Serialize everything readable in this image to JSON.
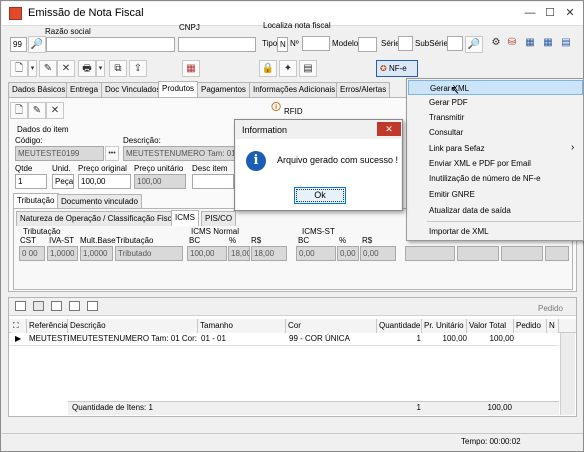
{
  "window": {
    "title": "Emissão de Nota Fiscal",
    "minimize": "—",
    "maximize": "☐",
    "close": "✕"
  },
  "form": {
    "razao_social_label": "Razão social",
    "cnpj_label": "CNPJ",
    "localiza_label": "Localiza nota fiscal",
    "tipo_label": "Tipo",
    "tipo_value": "N",
    "no_label": "Nº",
    "modelo_label": "Modelo",
    "serie_label": "Série",
    "subserie_label": "SubSérie",
    "prefix_value": "99"
  },
  "toolbar": {
    "nfe_label": "NF-e"
  },
  "tabs": [
    "Dados Básicos",
    "Entrega",
    "Doc Vinculados",
    "Produtos",
    "Pagamentos",
    "Informações Adicionais",
    "Erros/Alertas"
  ],
  "rfid_label": "RFID",
  "item": {
    "section_label": "Dados do item",
    "codigo_label": "Código:",
    "codigo_value": "MEUTESTE0199",
    "codigo_btn": "•••",
    "descricao_label": "Descrição:",
    "descricao_value": "MEUTESTENUMERO Tam: 01",
    "qtde_label": "Qtde",
    "qtde_value": "1",
    "unid_label": "Unid.",
    "unid_value": "Peça",
    "preco_original_label": "Preço original",
    "preco_original_value": "100,00",
    "preco_unitario_label": "Preço unitário",
    "preco_unitario_value": "100,00",
    "desc_item_label": "Desc item"
  },
  "subtabs": [
    "Tributação",
    "Documento vinculado"
  ],
  "taxtabs": [
    "Natureza de Operação / Classificação Fiscal",
    "ICMS",
    "PIS/CO"
  ],
  "tributacao": {
    "group_label": "Tributação",
    "icms_normal_label": "ICMS Normal",
    "icms_st_label": "ICMS-ST",
    "cols": [
      "CST",
      "IVA-ST",
      "Mult.Base",
      "Tributação",
      "BC",
      "%",
      "R$",
      "BC",
      "%",
      "R$"
    ],
    "values": [
      "0 00",
      "1,0000",
      "1,0000",
      "Tributado",
      "100,00",
      "18,00",
      "18,00",
      "0,00",
      "0,00",
      "0,00"
    ]
  },
  "grid": {
    "pedido_label": "Pedido",
    "headers": [
      "Referência",
      "Descrição",
      "Tamanho",
      "Cor",
      "Quantidade",
      "Pr. Unitário",
      "Valor Total",
      "Pedido",
      "N"
    ],
    "rows": [
      {
        "ref": "MEUTESTE",
        "desc": "MEUTESTENUMERO Tam: 01 Cor: CO",
        "tamanho": "01 - 01",
        "cor": "99 - COR ÚNICA",
        "qtd": "1",
        "unit": "100,00",
        "total": "100,00",
        "pedido": ""
      }
    ],
    "footer_label": "Quantidade de Itens: 1",
    "footer_qtd": "1",
    "footer_total": "100,00"
  },
  "status": {
    "tempo": "Tempo: 00:00:02"
  },
  "menu": {
    "items": [
      "Gerar XML",
      "Gerar PDF",
      "Transmitir",
      "Consultar",
      "Link para Sefaz",
      "Enviar XML e PDF por Email",
      "Inutilização de número de NF-e",
      "Emitir GNRE",
      "Atualizar data de saída",
      "Importar de XML"
    ],
    "submenu_arrow": "›"
  },
  "dialog": {
    "title": "Information",
    "message": "Arquivo gerado com sucesso !",
    "ok": "Ok",
    "close": "✕",
    "info_glyph": "i"
  },
  "colors": {
    "accent": "#0078d7",
    "close_red": "#c0392b",
    "menu_sel": "#cce4f7"
  }
}
